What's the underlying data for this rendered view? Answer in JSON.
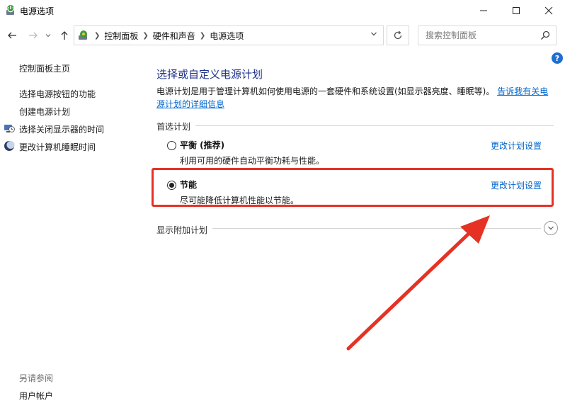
{
  "window": {
    "title": "电源选项"
  },
  "nav": {
    "breadcrumbs": [
      "控制面板",
      "硬件和声音",
      "电源选项"
    ],
    "search_placeholder": "搜索控制面板"
  },
  "sidebar": {
    "home": "控制面板主页",
    "items": [
      {
        "label": "选择电源按钮的功能"
      },
      {
        "label": "创建电源计划"
      },
      {
        "label": "选择关闭显示器的时间",
        "icon": "monitor-clock-icon"
      },
      {
        "label": "更改计算机睡眠时间",
        "icon": "moon-icon"
      }
    ],
    "see_also": "另请参阅",
    "user_accounts": "用户帐户"
  },
  "main": {
    "title": "选择或自定义电源计划",
    "description": "电源计划是用于管理计算机如何使用电源的一套硬件和系统设置(如显示器亮度、睡眠等)。",
    "description_link": "告诉我有关电源计划的详细信息",
    "preferred_label": "首选计划",
    "plans": [
      {
        "name": "平衡 (推荐)",
        "desc": "利用可用的硬件自动平衡功耗与性能。",
        "link": "更改计划设置",
        "selected": false
      },
      {
        "name": "节能",
        "desc": "尽可能降低计算机性能以节能。",
        "link": "更改计划设置",
        "selected": true
      }
    ],
    "extra_plans_label": "显示附加计划"
  },
  "colors": {
    "heading": "#1e3287",
    "link": "#0066cc",
    "highlight": "#e53224",
    "help": "#1f6fd1"
  }
}
